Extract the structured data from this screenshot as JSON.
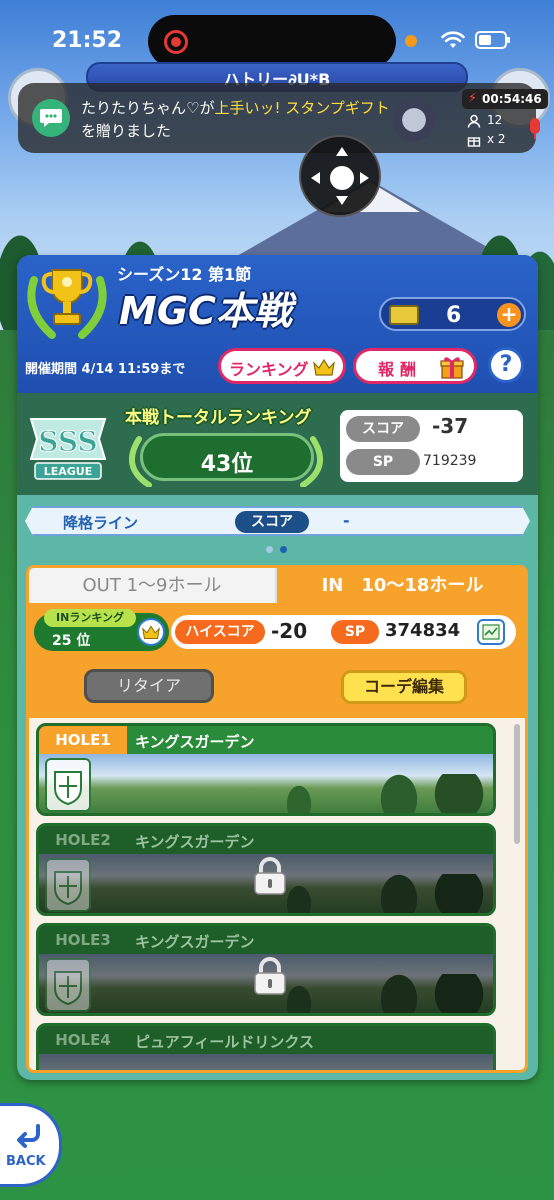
{
  "status_bar": {
    "time": "21:52"
  },
  "game_topbar": {
    "label": "ハトリー∂U*B"
  },
  "notification": {
    "line1_name": "たりたりちゃん♡が",
    "line1_highlight": "上手いッ! スタンプギフト",
    "line2": "を贈りました",
    "timer": "00:54:46",
    "viewers": "12",
    "gifts": "x 2",
    "icon": "chat-bubble-icon",
    "highlight_color": "#ffdf3a"
  },
  "header": {
    "season": "シーズン12 第1節",
    "title": "MGC本戦",
    "tickets": "6",
    "ticket_add": "+",
    "period": "開催期間 4/14 11:59まで",
    "ranking_button": "ランキング",
    "reward_button": "報酬",
    "help_button": "?"
  },
  "ranking": {
    "league_badge": "sss-league-icon",
    "total_label": "本戦トータルランキング",
    "total_rank": "43位",
    "score_label": "スコア",
    "score": "-37",
    "sp_label": "SP",
    "sp": "719239"
  },
  "demotion": {
    "label": "降格ライン",
    "score_label": "スコア",
    "value": "-"
  },
  "tabs": {
    "out": "OUT 1～9ホール",
    "in": "IN　10～18ホール",
    "active": "in"
  },
  "in_panel": {
    "rank_label": "INランキング",
    "rank": "25 位",
    "highscore_label": "ハイスコア",
    "highscore": "-20",
    "sp_label": "SP",
    "sp": "374834",
    "retire_button": "リタイア",
    "outfit_button": "コーデ編集"
  },
  "holes": [
    {
      "number": "HOLE1",
      "course": "キングスガーデン",
      "locked": false
    },
    {
      "number": "HOLE2",
      "course": "キングスガーデン",
      "locked": true
    },
    {
      "number": "HOLE3",
      "course": "キングスガーデン",
      "locked": true
    },
    {
      "number": "HOLE4",
      "course": "ピュアフィールドリンクス",
      "locked": true
    }
  ],
  "back_button": {
    "label": "BACK"
  },
  "colors": {
    "accent_orange": "#f6a22b",
    "header_blue": "#2a63c9",
    "ranking_pink": "#e02866"
  }
}
